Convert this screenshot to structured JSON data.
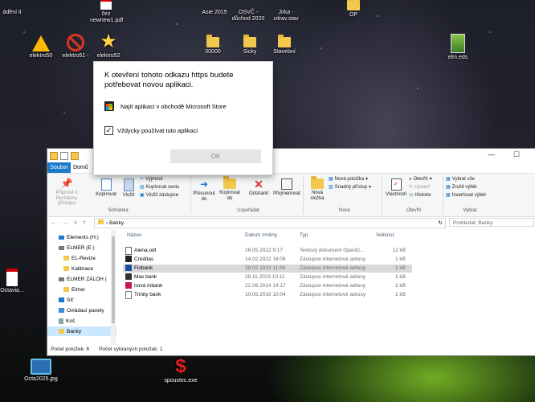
{
  "desktop": {
    "top_row_labels": [
      "ádění it",
      "čez newnew1.pdf",
      "Asie 2019",
      "OSVČ - důchod 2020",
      "Jirka - zdrav.stav",
      "OP"
    ],
    "icons": [
      {
        "label": "elektro50",
        "icon": "warning-icon"
      },
      {
        "label": "elektro51 -",
        "icon": "no-entry-icon"
      },
      {
        "label": "elektro52",
        "icon": "star-icon"
      },
      {
        "label": "00000",
        "icon": "folder-icon"
      },
      {
        "label": "Sicky",
        "icon": "folder-icon"
      },
      {
        "label": "Stavební",
        "icon": "folder-icon"
      },
      {
        "label": "elm.eds",
        "icon": "building-app-icon"
      },
      {
        "label": "Octavia...",
        "icon": "pdf-icon"
      },
      {
        "label": "Octa2025.jpg",
        "icon": "image-icon"
      },
      {
        "label": "spoustec.exe",
        "icon": "dollar-app-icon"
      }
    ]
  },
  "dialog": {
    "title": "K otevření tohoto odkazu https budete potřebovat novou aplikaci.",
    "store_option": "Najít aplikaci v obchodě Microsoft Store",
    "always_label": "Vždycky používat tuto aplikaci",
    "always_checked": true,
    "ok_label": "OK"
  },
  "explorer": {
    "tabs": {
      "file": "Soubor",
      "home": "Domů"
    },
    "ribbon": {
      "pin": "Připnout k Rychlému přístupu",
      "copy": "Kopírovat",
      "paste": "Vložit",
      "cut": "Vyjmout",
      "copy_path": "Kopírovat cestu",
      "paste_shortcut": "Vložit zástupce",
      "group_clipboard": "Schránka",
      "move_to": "Přesunout do",
      "copy_to": "Kopírovat do",
      "delete": "Odstranit",
      "rename": "Přejmenovat",
      "group_organize": "Uspořádat",
      "new_folder": "Nová složka",
      "new_item": "Nová položka",
      "easy_access": "Snadný přístup",
      "group_new": "Nové",
      "properties": "Vlastnosti",
      "open": "Otevřít",
      "edit": "Upravit",
      "history": "Historie",
      "group_open": "Otevřít",
      "select_all": "Vybrat vše",
      "select_none": "Zrušit výběr",
      "invert_selection": "Invertovat výběr",
      "group_select": "Vybrat"
    },
    "path": "Banky",
    "search_placeholder": "Prohledat: Banky",
    "nav_items": [
      "Elements (H:)",
      "ELMER (E:)",
      "EL-Revize",
      "Kalibrace",
      "ELMER ZÁLOH (",
      "Elmer",
      "Síť",
      "Ovládací panely",
      "Koš",
      "Banky"
    ],
    "columns": {
      "name": "Název",
      "date": "Datum změny",
      "type": "Typ",
      "size": "Velikost"
    },
    "files": [
      {
        "name": "Alena.odt",
        "date": "26.05.2022 9:17",
        "type": "Textový dokument OpenD...",
        "size": "12 kB"
      },
      {
        "name": "Creditas",
        "date": "14.02.2022 16:08",
        "type": "Zástupce internetové adresy",
        "size": "1 kB"
      },
      {
        "name": "Fiobank",
        "date": "28.02.2023 11:04",
        "type": "Zástupce internetové adresy",
        "size": "1 kB"
      },
      {
        "name": "Max bank",
        "date": "28.11.2023 10:11",
        "type": "Zástupce internetové adresy",
        "size": "1 kB"
      },
      {
        "name": "nová mbank",
        "date": "22.06.2014 14:17",
        "type": "Zástupce internetové adresy",
        "size": "1 kB"
      },
      {
        "name": "Trinity bank",
        "date": "10.05.2019 10:04",
        "type": "Zástupce internetové adresy",
        "size": "1 kB"
      }
    ],
    "selected_row": 2,
    "status": {
      "count": "Počet položek: 6",
      "selected": "Počet vybraných položek: 1"
    }
  }
}
